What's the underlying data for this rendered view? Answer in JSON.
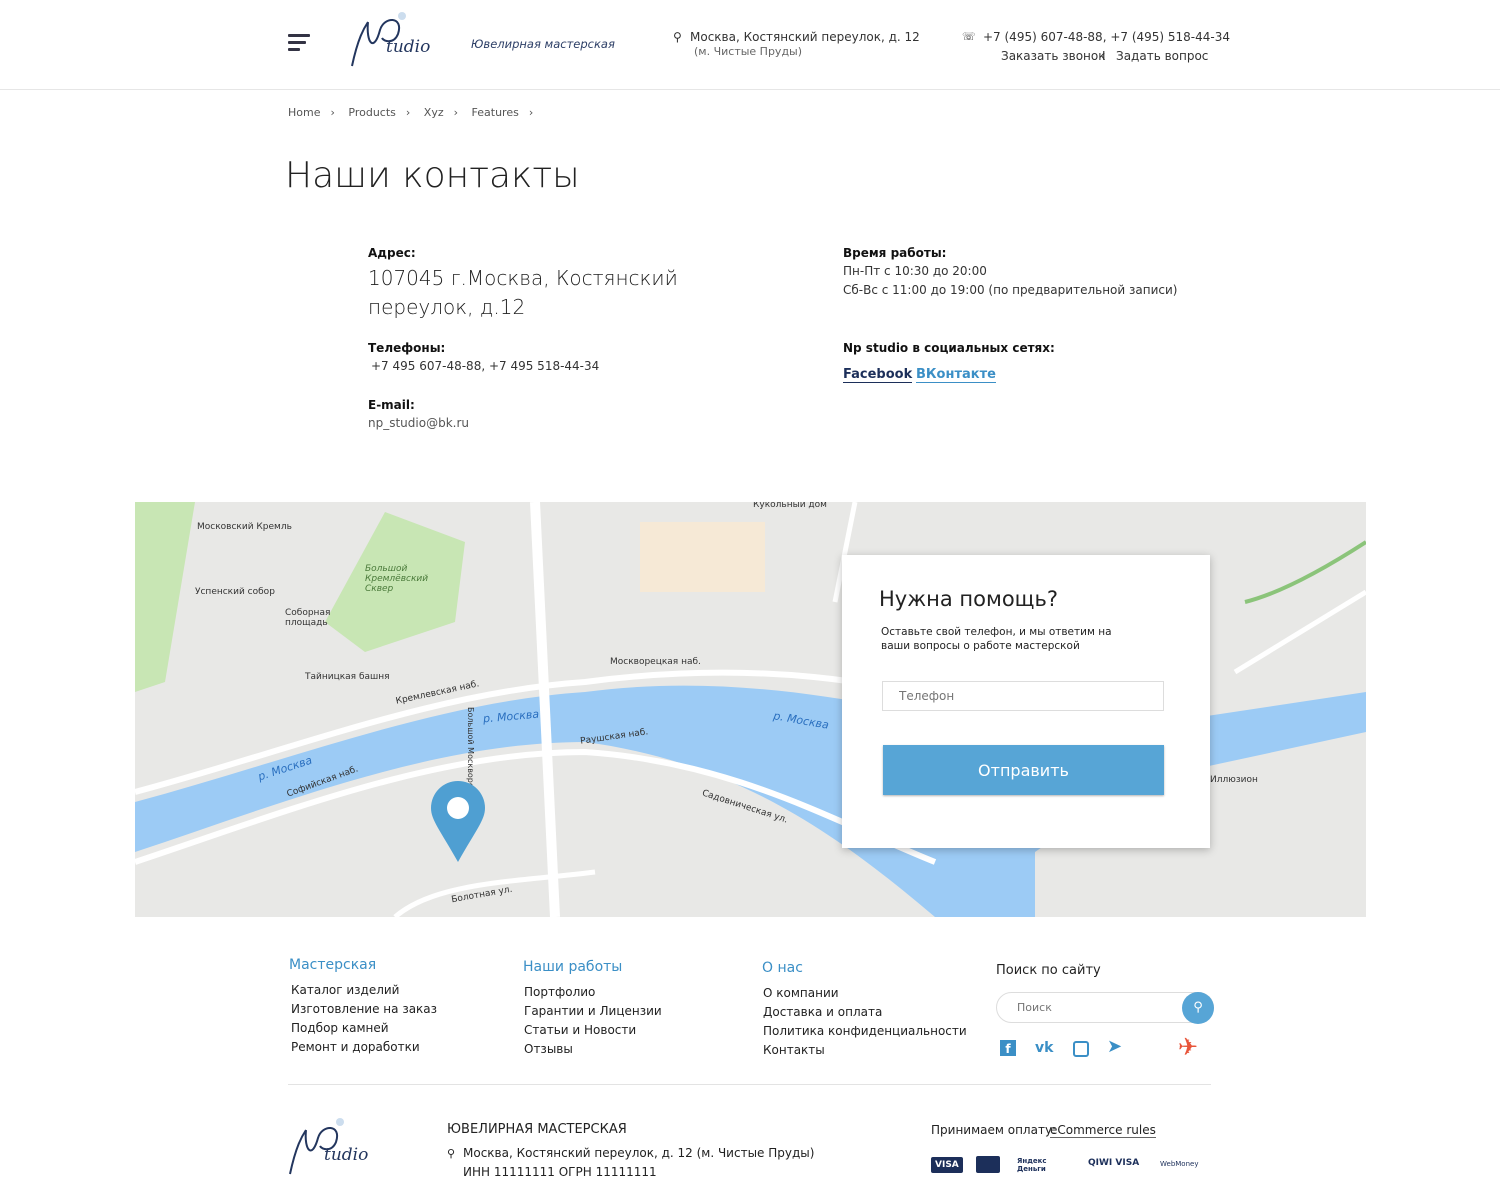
{
  "header": {
    "tagline": "Ювелирная мастерская",
    "address_line1": "Москва, Костянский переулок, д. 12",
    "address_line2": "(м. Чистые Пруды)",
    "phones": "+7 (495) 607-48-88, +7 (495) 518-44-34",
    "callback": "Заказать звонок",
    "separator": "I",
    "ask": "Задать вопрос",
    "logo_text": "NP Studio"
  },
  "breadcrumbs": [
    "Home",
    "Products",
    "Xyz",
    "Features"
  ],
  "page_title": "Наши контакты",
  "contacts": {
    "address_label": "Адрес:",
    "address": "107045 г.Москва, Костянский переулок, д.12",
    "phones_label": "Телефоны:",
    "phones": "+7 495 607-48-88, +7 495 518-44-34",
    "email_label": "E-mail:",
    "email": "np_studio@bk.ru",
    "hours_label": "Время работы:",
    "hours1": "Пн-Пт с 10:30 до 20:00",
    "hours2": "Сб-Вс с 11:00 до 19:00 (по предварительной записи)",
    "social_label": "Np studio в социальных сетях:",
    "facebook": "Facebook",
    "vk": "ВКонтакте"
  },
  "map": {
    "labels": [
      "Московский Кремль",
      "Успенский собор",
      "Соборная площадь",
      "Тайницкая башня",
      "Большой Кремлёвский Сквер",
      "Кремлевская наб.",
      "Софийская наб.",
      "Москворецкая наб.",
      "Раушская наб.",
      "Садовническая ул.",
      "Большой Москворецкий мост",
      "Болотная ул.",
      "Кукольный дом",
      "Иллюзион",
      "р. Москва"
    ]
  },
  "help_form": {
    "title": "Нужна помощь?",
    "text": "Оставьте свой телефон, и мы ответим на ваши вопросы о работе мастерской",
    "phone_placeholder": "Телефон",
    "submit": "Отправить"
  },
  "footer": {
    "columns": [
      {
        "title": "Мастерская",
        "items": [
          "Каталог изделий",
          "Изготовление на заказ",
          "Подбор камней",
          "Ремонт и доработки"
        ]
      },
      {
        "title": "Наши работы",
        "items": [
          "Портфолио",
          "Гарантии и Лицензии",
          "Статьи и Новости",
          "Отзывы"
        ]
      },
      {
        "title": "О нас",
        "items": [
          "О компании",
          "Доставка и оплата",
          "Политика конфиденциальности",
          "Контакты"
        ]
      }
    ],
    "search_title": "Поиск по сайту",
    "search_placeholder": "Поиск",
    "company": "ЮВЕЛИРНАЯ МАСТЕРСКАЯ",
    "address": "Москва, Костянский переулок, д. 12 (м. Чистые Пруды)",
    "ids": "ИНН 11111111 ОГРН 11111111",
    "payment_label": "Принимаем оплату:",
    "payment_link": "eCommerce rules",
    "payments": [
      "VISA",
      "MasterCard",
      "Яндекс Деньги",
      "QIWI VISA",
      "WebMoney"
    ]
  },
  "colors": {
    "accent": "#57a5d6",
    "link": "#3b8fc6",
    "dark": "#1c2f5a",
    "river": "#9ccbf5"
  }
}
